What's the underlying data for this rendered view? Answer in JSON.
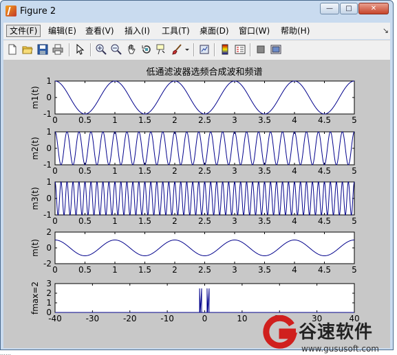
{
  "window": {
    "title": "Figure 2"
  },
  "titlebar_buttons": {
    "minimize": "—",
    "maximize": "□",
    "close": "✕"
  },
  "menus": [
    {
      "label": "文件(F)",
      "active": true
    },
    {
      "label": "编辑(E)"
    },
    {
      "label": "查看(V)"
    },
    {
      "label": "插入(I)"
    },
    {
      "label": "工具(T)"
    },
    {
      "label": "桌面(D)"
    },
    {
      "label": "窗口(W)"
    },
    {
      "label": "帮助(H)"
    }
  ],
  "menu_overflow": "↘",
  "toolbar": [
    "new-figure-icon",
    "open-folder-icon",
    "save-icon",
    "print-icon",
    "pointer-icon",
    "zoom-in-icon",
    "zoom-out-icon",
    "pan-hand-icon",
    "rotate-3d-icon",
    "data-cursor-icon",
    "brush-icon",
    "dropdown-arrow-icon",
    "link-plot-icon",
    "colorbar-icon",
    "legend-icon",
    "hide-plot-tools-icon",
    "show-plot-tools-icon"
  ],
  "colors": {
    "line": "#00008b",
    "figure_bg": "#c8c8c8",
    "axes_bg": "#ffffff"
  },
  "figure_title": "低通滤波器选频合成波和频谱",
  "chart_data": [
    {
      "type": "line",
      "ylabel": "m1(t)",
      "x": [
        0,
        5
      ],
      "ylim": [
        -1,
        1
      ],
      "xticks": [
        "0",
        "0.5",
        "1",
        "1.5",
        "2",
        "2.5",
        "3",
        "3.5",
        "4",
        "4.5",
        "5"
      ],
      "yticks": [
        "1",
        "0",
        "-1"
      ],
      "series": [
        {
          "values": "cos(2*pi*1*t)",
          "frequency_hz": 1
        }
      ]
    },
    {
      "type": "line",
      "ylabel": "m2(t)",
      "x": [
        0,
        5
      ],
      "ylim": [
        -1,
        1
      ],
      "xticks": [
        "0",
        "0.5",
        "1",
        "1.5",
        "2",
        "2.5",
        "3",
        "3.5",
        "4",
        "4.5",
        "5"
      ],
      "yticks": [
        "1",
        "0",
        "-1"
      ],
      "series": [
        {
          "values": "cos(2*pi*5*t)",
          "frequency_hz": 5
        }
      ]
    },
    {
      "type": "line",
      "ylabel": "m3(t)",
      "x": [
        0,
        5
      ],
      "ylim": [
        -1,
        1
      ],
      "xticks": [
        "0",
        "0.5",
        "1",
        "1.5",
        "2",
        "2.5",
        "3",
        "3.5",
        "4",
        "4.5",
        "5"
      ],
      "yticks": [
        "1",
        "0",
        "-1"
      ],
      "series": [
        {
          "values": "cos(2*pi*10*t)",
          "frequency_hz": 10
        }
      ]
    },
    {
      "type": "line",
      "ylabel": "m(t)",
      "x": [
        0,
        5
      ],
      "ylim": [
        -2,
        2
      ],
      "xticks": [
        "0",
        "0.5",
        "1",
        "1.5",
        "2",
        "2.5",
        "3",
        "3.5",
        "4",
        "4.5",
        "5"
      ],
      "yticks": [
        "2",
        "0",
        "-2"
      ],
      "series": [
        {
          "values": "cos(2*pi*1*t)",
          "frequency_hz": 1,
          "amplitude": 1
        }
      ]
    },
    {
      "type": "line",
      "ylabel": "fmax=2",
      "x": [
        -40,
        40
      ],
      "ylim": [
        0,
        3
      ],
      "xticks": [
        "-40",
        "-30",
        "-20",
        "-10",
        "0",
        "10",
        "20",
        "30",
        "40"
      ],
      "yticks": [
        "3",
        "2",
        "1",
        "0"
      ],
      "series": [
        {
          "x": [
            -1,
            1
          ],
          "values": [
            2.5,
            2.5
          ]
        }
      ]
    }
  ],
  "watermark": {
    "text": "谷速软件",
    "url": "www.gususoft.com"
  },
  "status_text": "……"
}
